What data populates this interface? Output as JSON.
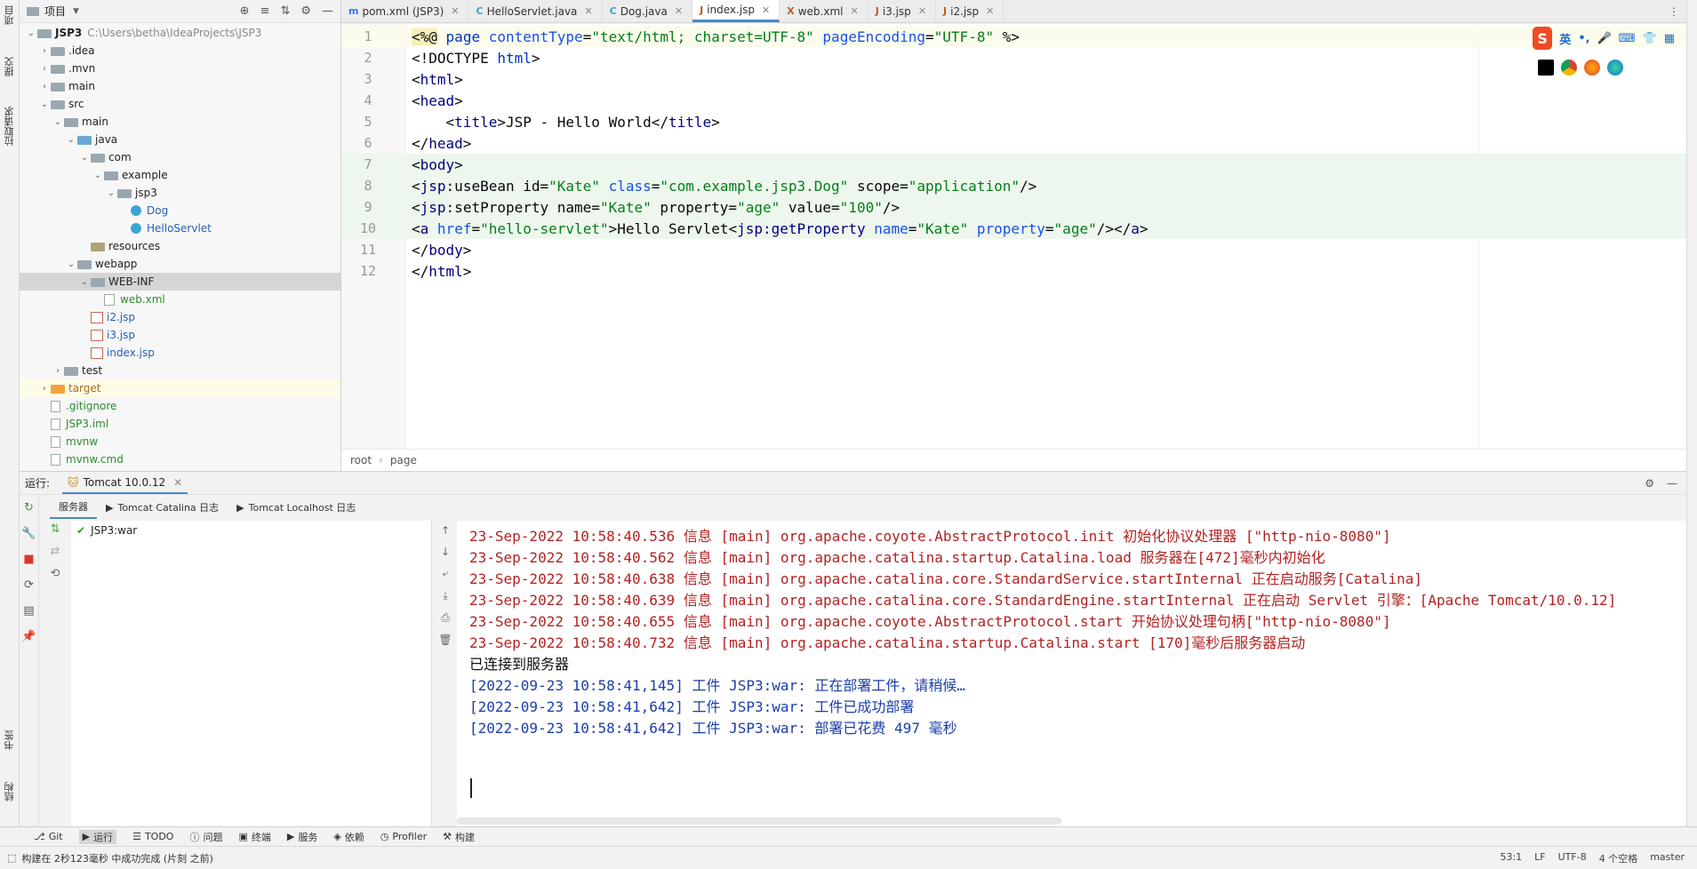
{
  "left_strip": {
    "items": [
      "项目",
      "提交",
      "拉取请求",
      "书签",
      "结构"
    ]
  },
  "project": {
    "title": "项目",
    "tree": [
      {
        "label": "JSP3",
        "path": "C:\\Users\\betha\\IdeaProjects\\JSP3",
        "depth": 0,
        "chev": "v",
        "icon": "folder"
      },
      {
        "label": ".idea",
        "depth": 1,
        "chev": ">",
        "icon": "folder"
      },
      {
        "label": ".mvn",
        "depth": 1,
        "chev": ">",
        "icon": "folder"
      },
      {
        "label": "main",
        "depth": 1,
        "chev": ">",
        "icon": "folder"
      },
      {
        "label": "src",
        "depth": 1,
        "chev": "v",
        "icon": "folder"
      },
      {
        "label": "main",
        "depth": 2,
        "chev": "v",
        "icon": "folder"
      },
      {
        "label": "java",
        "depth": 3,
        "chev": "v",
        "icon": "folder-blue"
      },
      {
        "label": "com",
        "depth": 4,
        "chev": "v",
        "icon": "folder"
      },
      {
        "label": "example",
        "depth": 5,
        "chev": "v",
        "icon": "folder"
      },
      {
        "label": "jsp3",
        "depth": 6,
        "chev": "v",
        "icon": "folder"
      },
      {
        "label": "Dog",
        "depth": 7,
        "chev": "",
        "icon": "class",
        "color": "blue"
      },
      {
        "label": "HelloServlet",
        "depth": 7,
        "chev": "",
        "icon": "class",
        "color": "blue"
      },
      {
        "label": "resources",
        "depth": 4,
        "chev": "",
        "icon": "folder-res"
      },
      {
        "label": "webapp",
        "depth": 3,
        "chev": "v",
        "icon": "folder"
      },
      {
        "label": "WEB-INF",
        "depth": 4,
        "chev": "v",
        "icon": "folder",
        "selected": true
      },
      {
        "label": "web.xml",
        "depth": 5,
        "chev": "",
        "icon": "xml",
        "color": "green"
      },
      {
        "label": "i2.jsp",
        "depth": 4,
        "chev": "",
        "icon": "jsp",
        "color": "blue"
      },
      {
        "label": "i3.jsp",
        "depth": 4,
        "chev": "",
        "icon": "jsp",
        "color": "blue"
      },
      {
        "label": "index.jsp",
        "depth": 4,
        "chev": "",
        "icon": "jsp",
        "color": "blue"
      },
      {
        "label": "test",
        "depth": 2,
        "chev": ">",
        "icon": "folder"
      },
      {
        "label": "target",
        "depth": 1,
        "chev": ">",
        "icon": "folder-orange",
        "color": "orange",
        "target": true
      },
      {
        "label": ".gitignore",
        "depth": 1,
        "chev": "",
        "icon": "file",
        "color": "green"
      },
      {
        "label": "JSP3.iml",
        "depth": 1,
        "chev": "",
        "icon": "file",
        "color": "green"
      },
      {
        "label": "mvnw",
        "depth": 1,
        "chev": "",
        "icon": "file",
        "color": "green"
      },
      {
        "label": "mvnw.cmd",
        "depth": 1,
        "chev": "",
        "icon": "file",
        "color": "green"
      }
    ]
  },
  "editor_tabs": [
    {
      "label": "pom.xml (JSP3)",
      "icon": "m",
      "active": false
    },
    {
      "label": "HelloServlet.java",
      "icon": "C",
      "active": false
    },
    {
      "label": "Dog.java",
      "icon": "C",
      "active": false
    },
    {
      "label": "index.jsp",
      "icon": "J",
      "active": true
    },
    {
      "label": "web.xml",
      "icon": "X",
      "active": false
    },
    {
      "label": "i3.jsp",
      "icon": "J",
      "active": false
    },
    {
      "label": "i2.jsp",
      "icon": "J",
      "active": false
    }
  ],
  "code_lines": [
    {
      "n": "1",
      "hl": "hl1",
      "segs": [
        [
          "dir",
          "<%@"
        ],
        [
          "pl",
          " "
        ],
        [
          "kw",
          "page"
        ],
        [
          "pl",
          " "
        ],
        [
          "at",
          "contentType"
        ],
        [
          "pl",
          "="
        ],
        [
          "st",
          "\"text/html; charset=UTF-8\""
        ],
        [
          "pl",
          " "
        ],
        [
          "at",
          "pageEncoding"
        ],
        [
          "pl",
          "="
        ],
        [
          "st",
          "\"UTF-8\""
        ],
        [
          "pl",
          " %>"
        ]
      ]
    },
    {
      "n": "2",
      "hl": "",
      "segs": [
        [
          "pl",
          "<!DOCTYPE "
        ],
        [
          "kw",
          "html"
        ],
        [
          "pl",
          ">"
        ]
      ]
    },
    {
      "n": "3",
      "hl": "",
      "segs": [
        [
          "pl",
          "<"
        ],
        [
          "tg",
          "html"
        ],
        [
          "pl",
          ">"
        ]
      ]
    },
    {
      "n": "4",
      "hl": "",
      "segs": [
        [
          "pl",
          "<"
        ],
        [
          "tg",
          "head"
        ],
        [
          "pl",
          ">"
        ]
      ]
    },
    {
      "n": "5",
      "hl": "",
      "segs": [
        [
          "pl",
          "    <"
        ],
        [
          "tg",
          "title"
        ],
        [
          "pl",
          ">JSP - Hello World</"
        ],
        [
          "tg",
          "title"
        ],
        [
          "pl",
          ">"
        ]
      ]
    },
    {
      "n": "6",
      "hl": "",
      "segs": [
        [
          "pl",
          "</"
        ],
        [
          "tg",
          "head"
        ],
        [
          "pl",
          ">"
        ]
      ]
    },
    {
      "n": "7",
      "hl": "hl2",
      "segs": [
        [
          "pl",
          "<"
        ],
        [
          "tg",
          "body"
        ],
        [
          "pl",
          ">"
        ]
      ]
    },
    {
      "n": "8",
      "hl": "hl2",
      "segs": [
        [
          "pl",
          "<"
        ],
        [
          "tg",
          "jsp"
        ],
        [
          "pl",
          ":useBean id="
        ],
        [
          "st",
          "\"Kate\""
        ],
        [
          "pl",
          " "
        ],
        [
          "at",
          "class"
        ],
        [
          "pl",
          "="
        ],
        [
          "st",
          "\"com.example.jsp3.Dog\""
        ],
        [
          "pl",
          " scope="
        ],
        [
          "st",
          "\"application\""
        ],
        [
          "pl",
          "/>"
        ]
      ]
    },
    {
      "n": "9",
      "hl": "hl2",
      "segs": [
        [
          "pl",
          "<"
        ],
        [
          "tg",
          "jsp"
        ],
        [
          "pl",
          ":setProperty name="
        ],
        [
          "st",
          "\"Kate\""
        ],
        [
          "pl",
          " property="
        ],
        [
          "st",
          "\"age\""
        ],
        [
          "pl",
          " value="
        ],
        [
          "st",
          "\"100\""
        ],
        [
          "pl",
          "/>"
        ]
      ]
    },
    {
      "n": "10",
      "hl": "hl2",
      "segs": [
        [
          "pl",
          "<"
        ],
        [
          "tg",
          "a"
        ],
        [
          "pl",
          " "
        ],
        [
          "at",
          "href"
        ],
        [
          "pl",
          "="
        ],
        [
          "st",
          "\"hello-servlet\""
        ],
        [
          "pl",
          ">Hello Servlet<"
        ],
        [
          "tg",
          "jsp:getProperty"
        ],
        [
          "pl",
          " "
        ],
        [
          "at",
          "name"
        ],
        [
          "pl",
          "="
        ],
        [
          "st",
          "\"Kate\""
        ],
        [
          "pl",
          " "
        ],
        [
          "at",
          "property"
        ],
        [
          "pl",
          "="
        ],
        [
          "st",
          "\"age\""
        ],
        [
          "pl",
          "/></"
        ],
        [
          "tg",
          "a"
        ],
        [
          "pl",
          ">"
        ]
      ]
    },
    {
      "n": "11",
      "hl": "",
      "segs": [
        [
          "pl",
          "</"
        ],
        [
          "tg",
          "body"
        ],
        [
          "pl",
          ">"
        ]
      ]
    },
    {
      "n": "12",
      "hl": "",
      "segs": [
        [
          "pl",
          "</"
        ],
        [
          "tg",
          "html"
        ],
        [
          "pl",
          ">"
        ]
      ]
    }
  ],
  "breadcrumb": [
    "root",
    "page"
  ],
  "ime": {
    "label": "英",
    "logo": "S"
  },
  "run": {
    "label": "运行:",
    "config": "Tomcat 10.0.12",
    "subtabs": [
      "服务器",
      "Tomcat Catalina 日志",
      "Tomcat Localhost 日志"
    ],
    "artifact": "JSP3:war",
    "logs": [
      {
        "c": "red",
        "t": "23-Sep-2022 10:58:40.536 信息 [main] org.apache.coyote.AbstractProtocol.init 初始化协议处理器 [\"http-nio-8080\"]"
      },
      {
        "c": "red",
        "t": "23-Sep-2022 10:58:40.562 信息 [main] org.apache.catalina.startup.Catalina.load 服务器在[472]毫秒内初始化"
      },
      {
        "c": "red",
        "t": "23-Sep-2022 10:58:40.638 信息 [main] org.apache.catalina.core.StandardService.startInternal 正在启动服务[Catalina]"
      },
      {
        "c": "red",
        "t": "23-Sep-2022 10:58:40.639 信息 [main] org.apache.catalina.core.StandardEngine.startInternal 正在启动 Servlet 引擎：[Apache Tomcat/10.0.12]"
      },
      {
        "c": "red",
        "t": "23-Sep-2022 10:58:40.655 信息 [main] org.apache.coyote.AbstractProtocol.start 开始协议处理句柄[\"http-nio-8080\"]"
      },
      {
        "c": "red",
        "t": "23-Sep-2022 10:58:40.732 信息 [main] org.apache.catalina.startup.Catalina.start [170]毫秒后服务器启动"
      },
      {
        "c": "black",
        "t": "已连接到服务器"
      },
      {
        "c": "blue",
        "t": "[2022-09-23 10:58:41,145] 工件 JSP3:war: 正在部署工件，请稍候…"
      },
      {
        "c": "blue",
        "t": "[2022-09-23 10:58:41,642] 工件 JSP3:war: 工件已成功部署"
      },
      {
        "c": "blue",
        "t": "[2022-09-23 10:58:41,642] 工件 JSP3:war: 部署已花费 497 毫秒"
      }
    ]
  },
  "bottom_bar": [
    {
      "label": "Git",
      "icon": "branch-icon",
      "active": false
    },
    {
      "label": "运行",
      "icon": "play-icon",
      "active": true
    },
    {
      "label": "TODO",
      "icon": "list-icon",
      "active": false
    },
    {
      "label": "问题",
      "icon": "problem-icon",
      "active": false
    },
    {
      "label": "终端",
      "icon": "terminal-icon",
      "active": false
    },
    {
      "label": "服务",
      "icon": "services-icon",
      "active": false
    },
    {
      "label": "依赖",
      "icon": "layers-icon",
      "active": false
    },
    {
      "label": "Profiler",
      "icon": "profiler-icon",
      "active": false
    },
    {
      "label": "构建",
      "icon": "hammer-icon",
      "active": false
    }
  ],
  "status": {
    "message": "构建在 2秒123毫秒 中成功完成 (片刻 之前)",
    "position": "53:1",
    "line_sep": "LF",
    "encoding": "UTF-8",
    "indent": "4 个空格",
    "branch": "master"
  }
}
